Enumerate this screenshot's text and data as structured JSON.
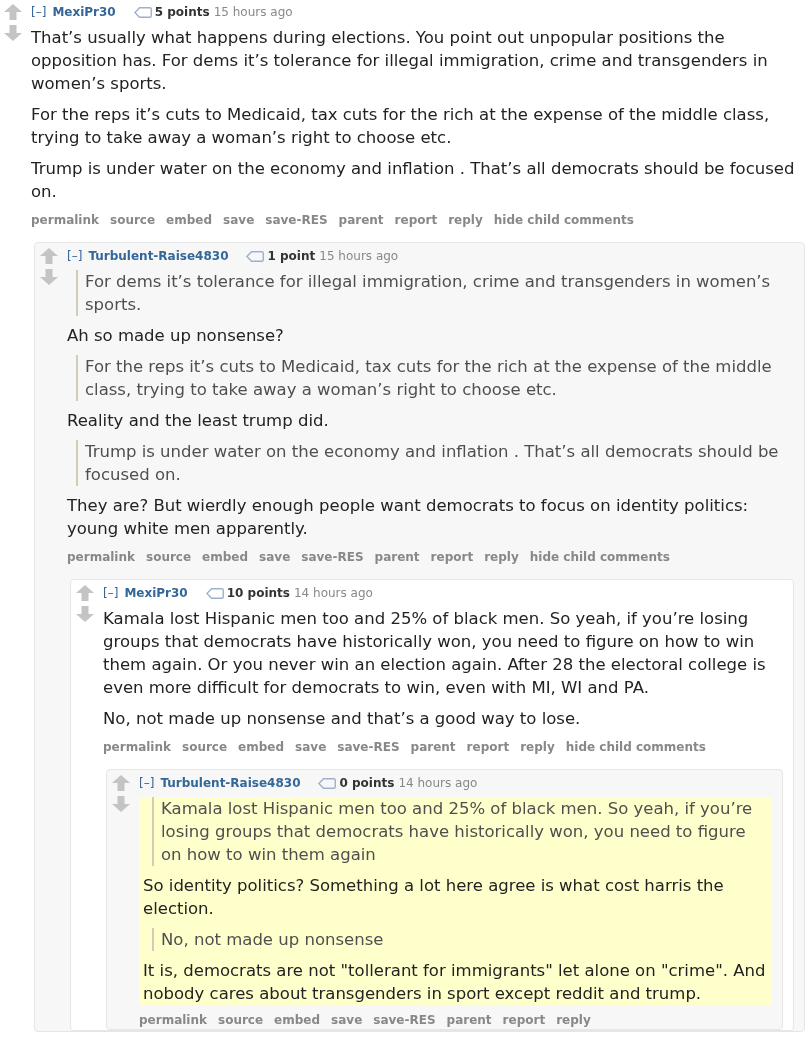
{
  "comments": [
    {
      "toggle": "[–]",
      "author": "MexiPr30",
      "points": "5 points",
      "time": "15 hours ago",
      "highlighted": false,
      "body": [
        {
          "kind": "text",
          "text": "That’s usually what happens during elections. You point out unpopular positions the opposition has. For dems it’s tolerance for illegal immigration, crime and transgenders in women’s sports."
        },
        {
          "kind": "text",
          "text": "For the reps it’s cuts to Medicaid, tax cuts for the rich at the expense of the middle class, trying to take away a woman’s right to choose etc."
        },
        {
          "kind": "text",
          "text": "Trump is under water on the economy and inflation . That’s all democrats should be focused on."
        }
      ],
      "actions": [
        "permalink",
        "source",
        "embed",
        "save",
        "save-RES",
        "parent",
        "report",
        "reply",
        "hide child comments"
      ],
      "children": [
        {
          "toggle": "[–]",
          "author": "Turbulent-Raise4830",
          "points": "1 point",
          "time": "15 hours ago",
          "highlighted": false,
          "body": [
            {
              "kind": "quote",
              "text": "For dems it’s tolerance for illegal immigration, crime and transgenders in women’s sports."
            },
            {
              "kind": "text",
              "text": "Ah so made up nonsense?"
            },
            {
              "kind": "quote",
              "text": "For the reps it’s cuts to Medicaid, tax cuts for the rich at the expense of the middle class, trying to take away a woman’s right to choose etc."
            },
            {
              "kind": "text",
              "text": "Reality and the least trump did."
            },
            {
              "kind": "quote",
              "text": "Trump is under water on the economy and inflation . That’s all democrats should be focused on."
            },
            {
              "kind": "text",
              "text": "They are? But wierdly enough people want democrats to focus on identity politics: young white men apparently."
            }
          ],
          "actions": [
            "permalink",
            "source",
            "embed",
            "save",
            "save-RES",
            "parent",
            "report",
            "reply",
            "hide child comments"
          ],
          "children": [
            {
              "toggle": "[–]",
              "author": "MexiPr30",
              "points": "10 points",
              "time": "14 hours ago",
              "highlighted": false,
              "body": [
                {
                  "kind": "text",
                  "text": "Kamala lost Hispanic men too and 25% of black men. So yeah, if you’re losing groups that democrats have historically won, you need to figure on how to win them again. Or you never win an election again. After 28 the electoral college is even more difficult for democrats to win, even with MI, WI and PA."
                },
                {
                  "kind": "text",
                  "text": "No, not made up nonsense and that’s a good way to lose."
                }
              ],
              "actions": [
                "permalink",
                "source",
                "embed",
                "save",
                "save-RES",
                "parent",
                "report",
                "reply",
                "hide child comments"
              ],
              "children": [
                {
                  "toggle": "[–]",
                  "author": "Turbulent-Raise4830",
                  "points": "0 points",
                  "time": "14 hours ago",
                  "highlighted": true,
                  "body": [
                    {
                      "kind": "quote",
                      "text": "Kamala lost Hispanic men too and 25% of black men. So yeah, if you’re losing groups that democrats have historically won, you need to figure on how to win them again"
                    },
                    {
                      "kind": "text",
                      "text": "So identity politics? Something a lot here agree is what cost harris the election."
                    },
                    {
                      "kind": "quote",
                      "text": "No, not made up nonsense"
                    },
                    {
                      "kind": "text",
                      "text": "It is, democrats are not \"tollerant for immigrants\" let alone on \"crime\". And nobody cares about transgenders in sport except reddit and trump."
                    }
                  ],
                  "actions": [
                    "permalink",
                    "source",
                    "embed",
                    "save",
                    "save-RES",
                    "parent",
                    "report",
                    "reply"
                  ]
                }
              ]
            }
          ]
        }
      ]
    }
  ]
}
